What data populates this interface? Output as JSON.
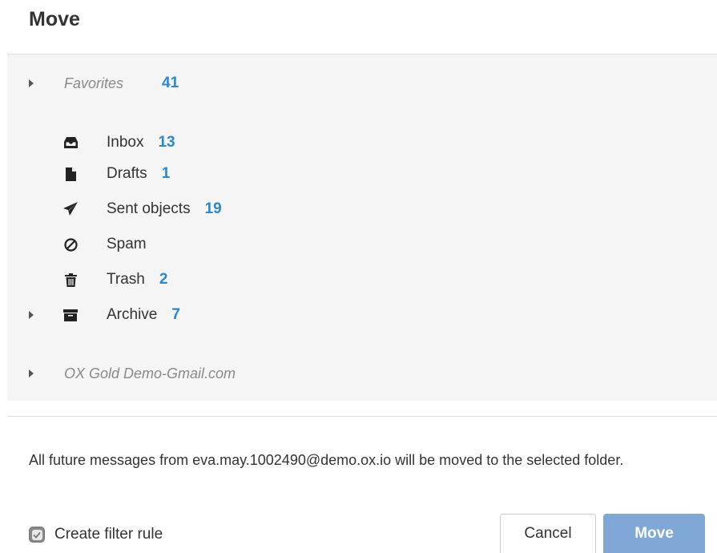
{
  "dialog": {
    "title": "Move"
  },
  "tree": {
    "favorites": {
      "label": "Favorites",
      "count": "41"
    },
    "folders": [
      {
        "label": "Inbox",
        "count": "13",
        "icon": "inbox-icon"
      },
      {
        "label": "Drafts",
        "count": "1",
        "icon": "file-icon"
      },
      {
        "label": "Sent objects",
        "count": "19",
        "icon": "paper-plane-icon"
      },
      {
        "label": "Spam",
        "count": "",
        "icon": "ban-icon"
      },
      {
        "label": "Trash",
        "count": "2",
        "icon": "trash-icon"
      },
      {
        "label": "Archive",
        "count": "7",
        "icon": "archive-icon"
      }
    ],
    "account": {
      "label": "OX Gold Demo-Gmail.com"
    }
  },
  "info": {
    "text": "All future messages from eva.may.1002490@demo.ox.io will be moved to the selected folder."
  },
  "filter": {
    "label": "Create filter rule",
    "checked": true
  },
  "buttons": {
    "cancel": "Cancel",
    "move": "Move"
  },
  "colors": {
    "count": "#2a87d1",
    "primary_button": "#7fa8d6",
    "tree_background": "#f5f5f5"
  }
}
